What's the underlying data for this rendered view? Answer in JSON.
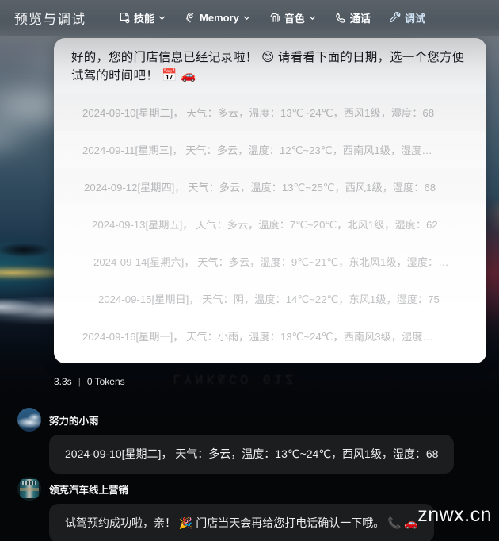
{
  "topbar": {
    "title": "预览与调试",
    "nav": [
      {
        "label": "技能",
        "icon": "skill-icon",
        "caret": true,
        "active": false
      },
      {
        "label": "Memory",
        "icon": "memory-icon",
        "caret": true,
        "active": false
      },
      {
        "label": "音色",
        "icon": "voice-icon",
        "caret": true,
        "active": false
      },
      {
        "label": "通话",
        "icon": "phone-icon",
        "caret": false,
        "active": false
      },
      {
        "label": "调试",
        "icon": "wrench-icon",
        "caret": false,
        "active": true
      }
    ]
  },
  "assistant_card": {
    "headline": "好的，您的门店信息已经记录啦！ 😊 请看看下面的日期，选一个您方便试驾的时间吧！ 📅 🚗",
    "date_options": [
      "2024-09-10[星期二]， 天气：多云，温度：13℃~24℃，西风1级，湿度：68",
      "2024-09-11[星期三]， 天气：多云，温度：12℃~23℃，西南风1级，湿度…",
      "2024-09-12[星期四]， 天气：多云，温度：13℃~25℃，西风1级，湿度：68",
      "2024-09-13[星期五]， 天气：多云，温度：7℃~20℃，北风1级，湿度：62",
      "2024-09-14[星期六]， 天气：多云，温度：9℃~21℃，东北风1级，湿度：…",
      "2024-09-15[星期日]， 天气：阴，温度：14℃~22℃，东风1级，湿度：75",
      "2024-09-16[星期一]， 天气：小雨，温度：13℃~24℃，西南风3级，湿度…"
    ]
  },
  "meta": {
    "latency": "3.3s",
    "separator": "|",
    "tokens": "0 Tokens"
  },
  "messages": [
    {
      "role": "user",
      "sender": "努力的小雨",
      "avatar": "user-avatar",
      "text": "2024-09-10[星期二]， 天气：多云，温度：13℃~24℃，西风1级，湿度：68"
    },
    {
      "role": "assistant",
      "sender": "领克汽车线上营销",
      "avatar": "brand-avatar",
      "text": "试驾预约成功啦，亲！ 🎉 门店当天会再给您打电话确认一下哦。 📞 🚗"
    }
  ],
  "background": {
    "plate_text": "LYNK&CO 01Z"
  },
  "watermark": "znwx.cn",
  "colors": {
    "topbar": "#5a636c",
    "card": "#ffffff",
    "bubble": "#1c1d1f",
    "active_nav": "#cfe3f5",
    "muted_text": "#b6b7b9"
  }
}
